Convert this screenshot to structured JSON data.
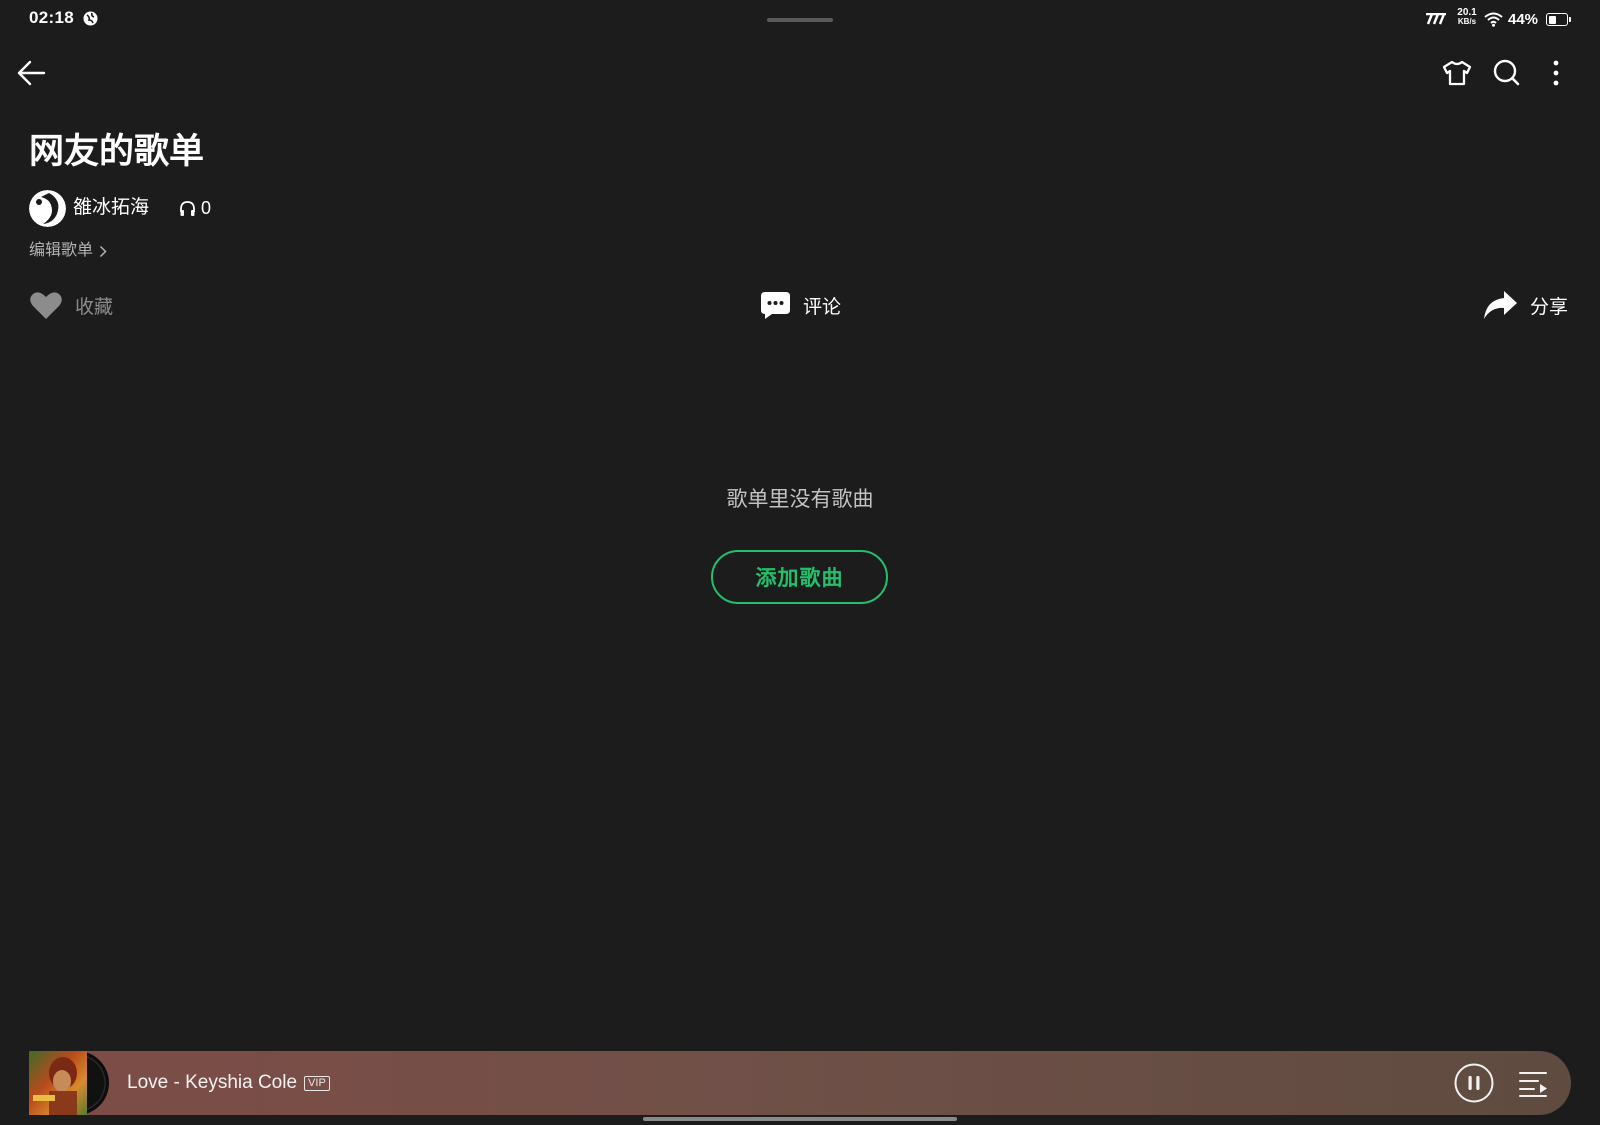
{
  "status_bar": {
    "time": "02:18",
    "net_speed_value": "20.1",
    "net_speed_unit": "KB/s",
    "battery": "44%",
    "battery_level": 0.44,
    "icons": [
      "globe-icon",
      "signal-icon",
      "wifi-icon",
      "battery-icon"
    ]
  },
  "nav": {
    "icons": [
      "back-arrow-icon",
      "shirt-icon",
      "search-icon",
      "more-vertical-icon"
    ]
  },
  "playlist": {
    "title": "网友的歌单",
    "creator": "雒冰拓海",
    "listen_count": "0",
    "edit_label": "编辑歌单"
  },
  "actions": {
    "favorite": "收藏",
    "comment": "评论",
    "share": "分享"
  },
  "empty_state": {
    "message": "歌单里没有歌曲",
    "add_button": "添加歌曲"
  },
  "mini_player": {
    "song": "Love - Keyshia Cole",
    "badge": "VIP",
    "icons": [
      "pause-icon",
      "playlist-queue-icon"
    ]
  },
  "colors": {
    "background": "#1c1c1c",
    "accent": "#22c06a",
    "player_start": "#7e4c47",
    "player_end": "#5f4b40"
  }
}
